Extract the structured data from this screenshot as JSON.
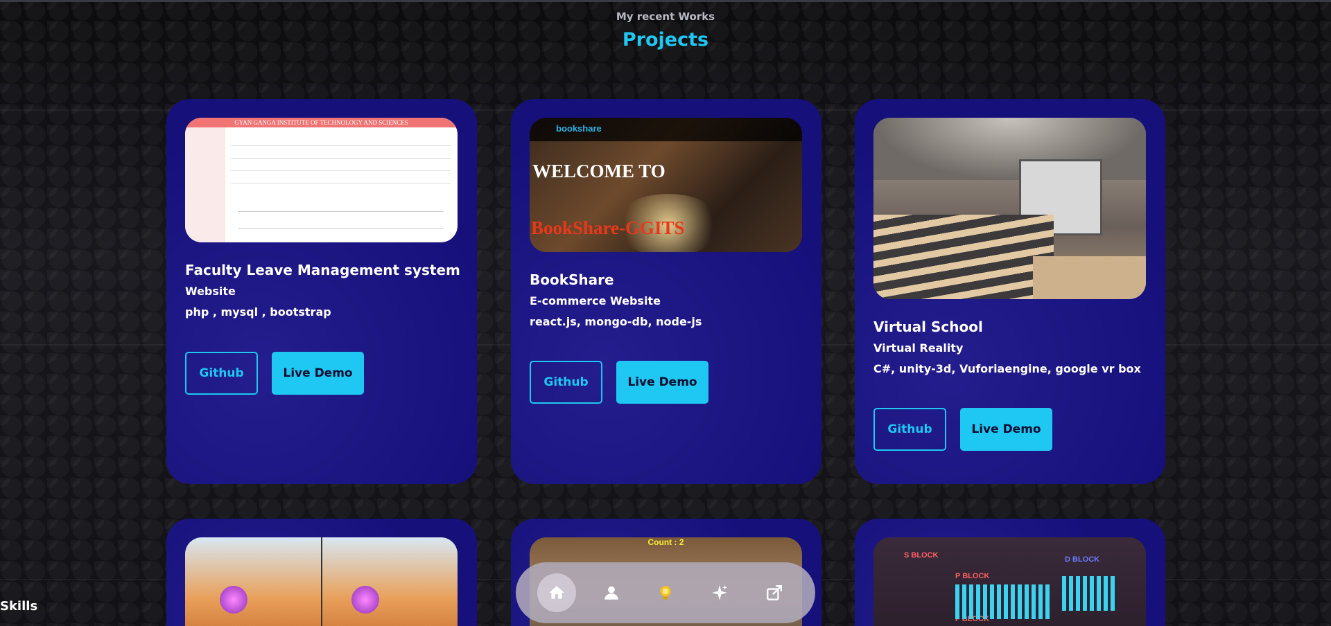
{
  "section": {
    "eyebrow": "My recent Works",
    "heading": "Projects"
  },
  "projects": [
    {
      "title": "Faculty Leave Management system",
      "type": "Website",
      "stack": "php , mysql , bootstrap",
      "github_label": "Github",
      "demo_label": "Live Demo",
      "thumb_banner": "GYAN GANGA INSTITUTE OF TECHNOLOGY AND SCIENCES"
    },
    {
      "title": "BookShare",
      "type": "E-commerce Website",
      "stack": "react.js, mongo-db, node-js",
      "github_label": "Github",
      "demo_label": "Live Demo",
      "thumb_logo": "bookshare",
      "thumb_line1": "WELCOME TO",
      "thumb_line2": "BookShare-GGITS"
    },
    {
      "title": "Virtual School",
      "type": "Virtual Reality",
      "stack": "C#, unity-3d, Vuforiaengine, google vr box",
      "github_label": "Github",
      "demo_label": "Live Demo"
    }
  ],
  "lower_projects": [
    {
      "thumb_text": ""
    },
    {
      "thumb_text": "Count : 2"
    },
    {
      "thumb_labels": [
        "S BLOCK",
        "P BLOCK",
        "D BLOCK",
        "F BLOCK"
      ]
    }
  ],
  "dock": {
    "items": [
      {
        "icon": "home-icon"
      },
      {
        "icon": "user-icon"
      },
      {
        "icon": "lightbulb-icon"
      },
      {
        "icon": "sparkles-icon"
      },
      {
        "icon": "share-icon"
      }
    ]
  },
  "next_section_label": "Skills",
  "colors": {
    "accent": "#1ec8f2",
    "card": "#15107a",
    "background": "#111114"
  }
}
